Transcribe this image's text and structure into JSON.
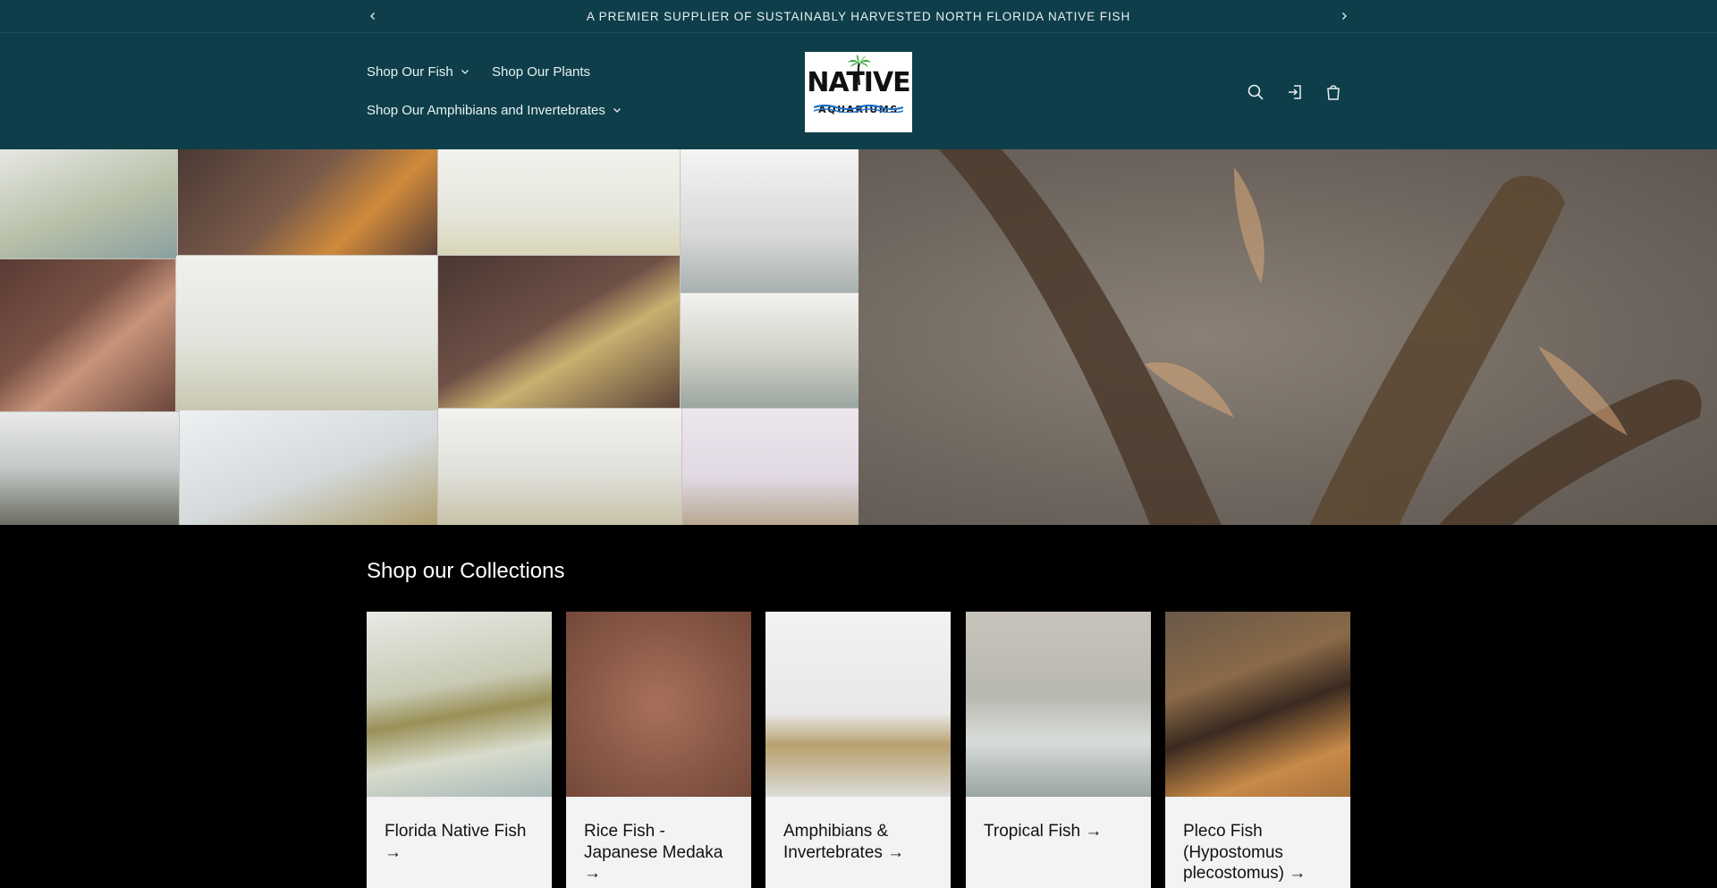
{
  "announcement": {
    "message": "A PREMIER SUPPLIER OF SUSTAINABLY HARVESTED NORTH FLORIDA NATIVE FISH"
  },
  "header": {
    "nav": [
      {
        "label": "Shop Our Fish",
        "has_dropdown": true
      },
      {
        "label": "Shop Our Plants",
        "has_dropdown": false
      },
      {
        "label": "Shop Our Amphibians and Invertebrates",
        "has_dropdown": true
      }
    ],
    "logo": {
      "line1": "NATIVE",
      "line2": "AQUARIUMS"
    },
    "icons": [
      "search-icon",
      "account-icon",
      "cart-icon"
    ]
  },
  "collections": {
    "title": "Shop our Collections",
    "items": [
      {
        "label": "Florida Native Fish →"
      },
      {
        "label": "Rice Fish - Japanese Medaka →"
      },
      {
        "label": "Amphibians & Invertebrates →"
      },
      {
        "label": "Tropical Fish →"
      },
      {
        "label": "Pleco Fish (Hypostomus plecostomus) →"
      }
    ]
  },
  "colors": {
    "header_bg": "#0e3e4a",
    "page_bg": "#000000",
    "card_bg": "#f3f3f3"
  }
}
